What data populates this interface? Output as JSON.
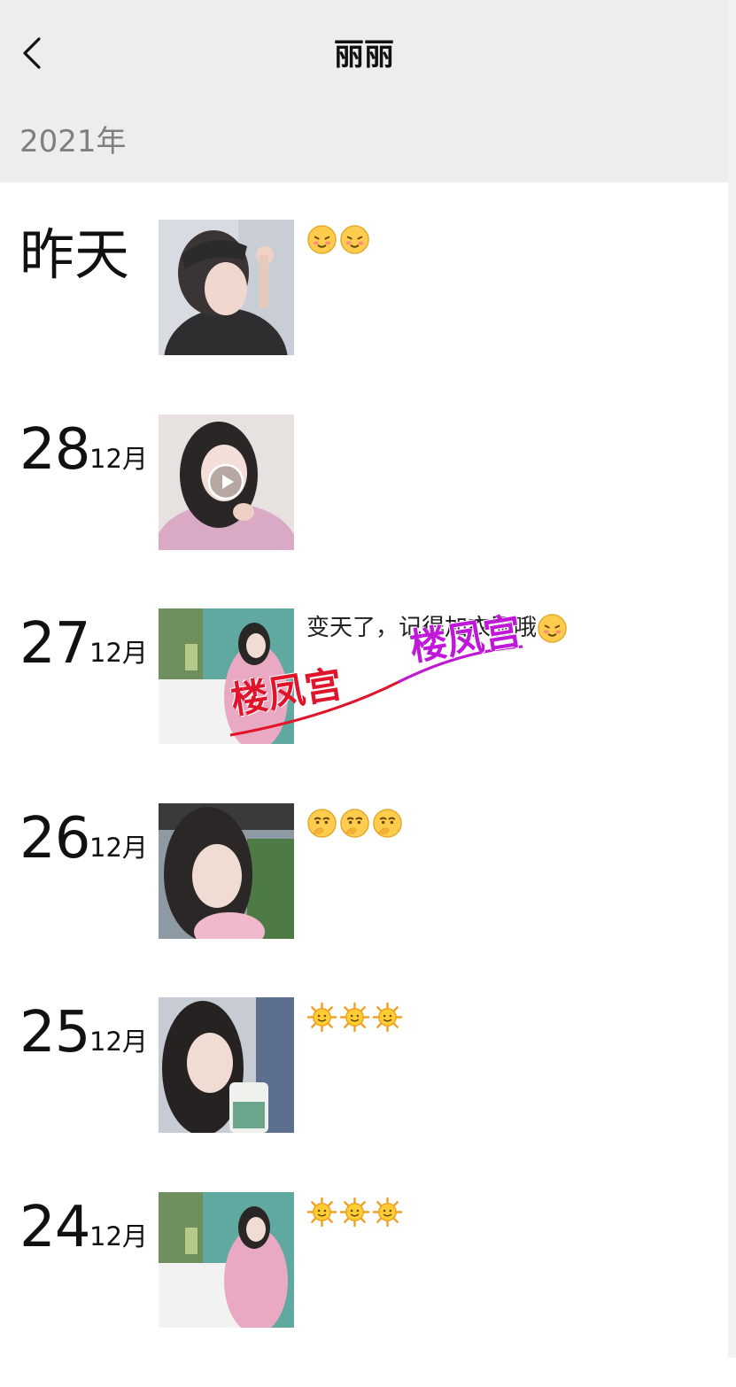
{
  "header": {
    "title": "丽丽",
    "year": "2021年"
  },
  "posts": [
    {
      "date_label": "昨天",
      "day": "",
      "month": "",
      "caption_text": "",
      "emojis": [
        "blush-emoji",
        "blush-emoji"
      ],
      "media": "photo"
    },
    {
      "date_label": "",
      "day": "28",
      "month": "12月",
      "caption_text": "",
      "emojis": [],
      "media": "video"
    },
    {
      "date_label": "",
      "day": "27",
      "month": "12月",
      "caption_text": "变天了，记得加衣服哦",
      "emojis": [
        "blush-emoji"
      ],
      "media": "photo"
    },
    {
      "date_label": "",
      "day": "26",
      "month": "12月",
      "caption_text": "",
      "emojis": [
        "thinking-emoji",
        "thinking-emoji",
        "thinking-emoji"
      ],
      "media": "photo"
    },
    {
      "date_label": "",
      "day": "25",
      "month": "12月",
      "caption_text": "",
      "emojis": [
        "sun-emoji",
        "sun-emoji",
        "sun-emoji"
      ],
      "media": "photo"
    },
    {
      "date_label": "",
      "day": "24",
      "month": "12月",
      "caption_text": "",
      "emojis": [
        "sun-emoji",
        "sun-emoji",
        "sun-emoji"
      ],
      "media": "photo"
    }
  ],
  "watermark": {
    "text_1": "楼凤宫",
    "text_2": "楼凤宫"
  },
  "colors": {
    "header_bg": "#ededed",
    "year_text": "#7f7f7f",
    "watermark_red": "#e0142a",
    "watermark_purple": "#c018d8"
  }
}
